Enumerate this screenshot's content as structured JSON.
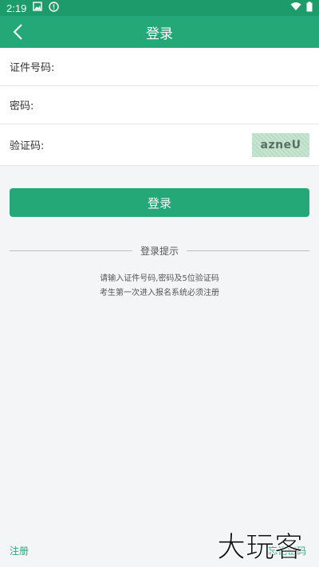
{
  "status_bar": {
    "time": "2:19"
  },
  "toolbar": {
    "title": "登录"
  },
  "form": {
    "id_label": "证件号码:",
    "password_label": "密码:",
    "captcha_label": "验证码:",
    "captcha_text": "azneU"
  },
  "login_button": "登录",
  "tips": {
    "title": "登录提示",
    "line1": "请输入证件号码,密码及5位验证码",
    "line2": "考生第一次进入报名系统必须注册"
  },
  "bottom": {
    "register": "注册",
    "forgot": "忘记密码"
  },
  "watermark_text": "大玩客",
  "colors": {
    "primary": "#24a878",
    "status_bar": "#1e9b6b",
    "background": "#f4f5f7"
  }
}
